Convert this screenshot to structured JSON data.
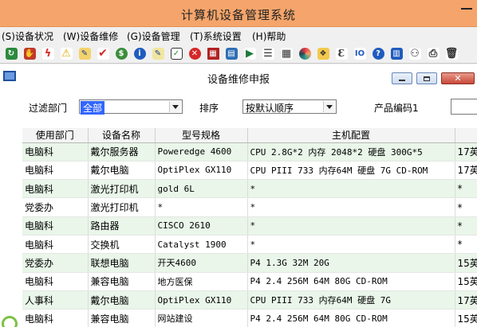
{
  "app": {
    "title": "计算机设备管理系统"
  },
  "menu": [
    "(S)设备状况",
    "(W)设备维修",
    "(G)设备管理",
    "(T)系统设置",
    "(H)帮助"
  ],
  "toolbar_icons": [
    "refresh-icon",
    "stop-icon",
    "lightning-icon",
    "warning-icon",
    "edit-icon",
    "check-icon",
    "money-bag-icon",
    "info-icon",
    "notepad-edit-icon",
    "checkbox-icon",
    "close-circle-icon",
    "calculator-icon",
    "database-icon",
    "play-icon",
    "list-icon",
    "grid-icon",
    "color-wheel-icon",
    "tags-icon",
    "e-text-icon",
    "io-icon",
    "question-icon",
    "book-icon",
    "network-icon",
    "printer-icon",
    "trash-icon"
  ],
  "child_window": {
    "title": "设备维修申报"
  },
  "filter": {
    "dept_label": "过滤部门",
    "dept_value": "全部",
    "sort_label": "排序",
    "sort_value": "按默认顺序",
    "code_label": "产品编码1",
    "code_value": ""
  },
  "table": {
    "columns": [
      "使用部门",
      "设备名称",
      "型号规格",
      "主机配置",
      ""
    ],
    "rows": [
      [
        "电脑科",
        "戴尔服务器",
        "Poweredge 4600",
        "CPU 2.8G*2 内存 2048*2 硬盘 300G*5",
        "17英"
      ],
      [
        "电脑科",
        "戴尔电脑",
        "OptiPlex GX110",
        "CPU PIII 733 内存64M 硬盘 7G CD-ROM",
        "17英"
      ],
      [
        "电脑科",
        "激光打印机",
        "gold 6L",
        "*",
        "*"
      ],
      [
        "党委办",
        "激光打印机",
        "*",
        "*",
        "*"
      ],
      [
        "电脑科",
        "路由器",
        "CISCO 2610",
        "*",
        "*"
      ],
      [
        "电脑科",
        "交换机",
        "Catalyst 1900",
        "*",
        "*"
      ],
      [
        "党委办",
        "联想电脑",
        "开天4600",
        "P4 1.3G 32M 20G",
        "15英"
      ],
      [
        "电脑科",
        "兼容电脑",
        "地方医保",
        "P4 2.4 256M 64M 80G CD-ROM",
        "15英"
      ],
      [
        "人事科",
        "戴尔电脑",
        "OptiPlex GX110",
        "CPU PIII 733 内存64M 硬盘 7G",
        "17英"
      ],
      [
        "电脑科",
        "兼容电脑",
        "网站建设",
        "P4 2.4 256M 64M 80G CD-ROM",
        "15英"
      ]
    ]
  },
  "colors": {
    "title_bar": "#f5a56b",
    "row_alt": "#e9f6e9",
    "selection": "#3366ff"
  }
}
